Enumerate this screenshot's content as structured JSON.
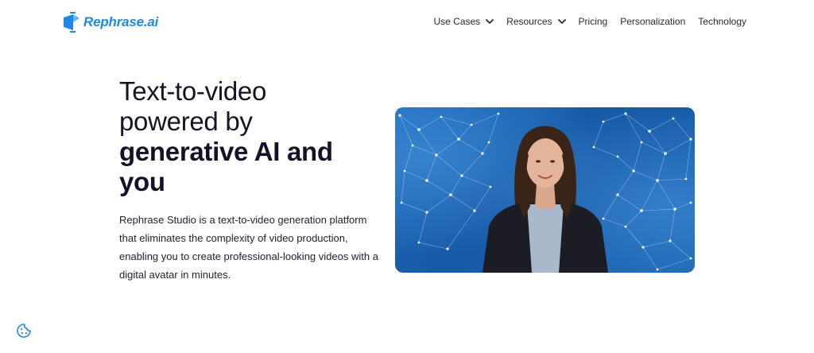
{
  "brand": {
    "name": "Rephrase.ai",
    "color": "#1e88e5"
  },
  "nav": {
    "items": [
      {
        "label": "Use Cases",
        "dropdown": true
      },
      {
        "label": "Resources",
        "dropdown": true
      },
      {
        "label": "Pricing",
        "dropdown": false
      },
      {
        "label": "Personalization",
        "dropdown": false
      },
      {
        "label": "Technology",
        "dropdown": false
      }
    ]
  },
  "hero": {
    "title_line1": "Text-to-video",
    "title_line2": "powered by",
    "title_line3": "generative AI and",
    "title_line4": "you",
    "description": "Rephrase Studio is a text-to-video generation platform that eliminates the complexity of video production, enabling you to create professional-looking videos with a digital avatar in minutes."
  },
  "media": {
    "subject": "digital-avatar-woman",
    "background": "#1d6cc0"
  },
  "cookie": {
    "icon": "cookie-icon",
    "color": "#1e88e5"
  }
}
